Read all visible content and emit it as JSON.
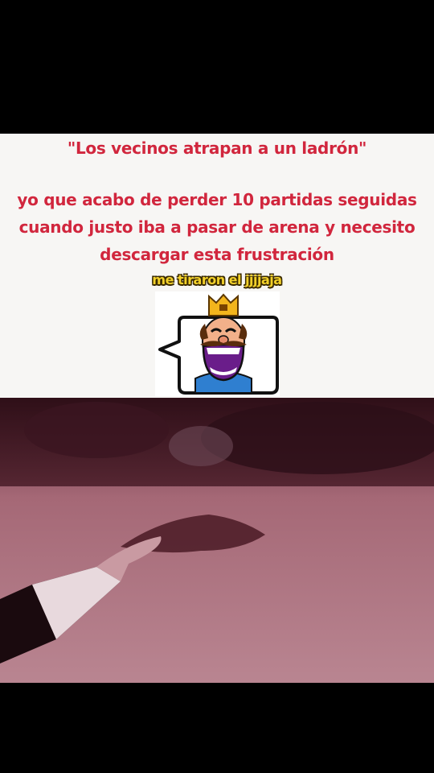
{
  "caption": {
    "quote": "\"Los vecinos atrapan a un ladrón\"",
    "lines": [
      "yo que acabo de perder 10 partidas seguidas",
      "cuando justo iba a pasar de arena y necesito",
      "descargar esta frustración"
    ]
  },
  "sticker": {
    "text": "me tiraron el jjjjaja"
  },
  "emote": {
    "icon": "laughing-king-emote-icon"
  },
  "video": {
    "description_icon": "video-frame"
  },
  "colors": {
    "caption_red": "#d1263d",
    "sticker_yellow": "#f2d02a",
    "panel_bg": "#f7f6f4"
  }
}
